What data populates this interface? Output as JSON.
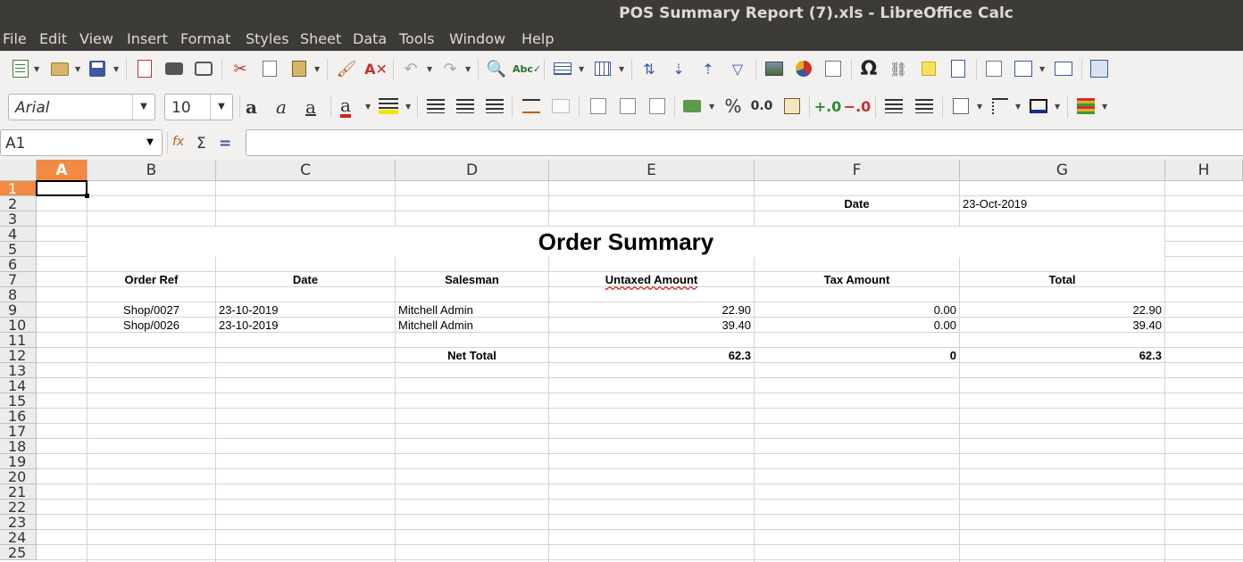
{
  "window": {
    "title": "POS Summary Report (7).xls - LibreOffice Calc"
  },
  "menu": [
    "File",
    "Edit",
    "View",
    "Insert",
    "Format",
    "Styles",
    "Sheet",
    "Data",
    "Tools",
    "Window",
    "Help"
  ],
  "format": {
    "font_name": "Arial",
    "font_size": "10"
  },
  "formula_bar": {
    "cell_ref": "A1",
    "formula": ""
  },
  "columns": [
    "A",
    "B",
    "C",
    "D",
    "E",
    "F",
    "G",
    "H"
  ],
  "rows": [
    "1",
    "2",
    "3",
    "4",
    "5",
    "6",
    "7",
    "8",
    "9",
    "10",
    "11",
    "12",
    "13",
    "14",
    "15",
    "16",
    "17",
    "18",
    "19",
    "20",
    "21",
    "22",
    "23",
    "24",
    "25"
  ],
  "report": {
    "date_label": "Date",
    "date_value": "23-Oct-2019",
    "title": "Order Summary",
    "headers": [
      "Order Ref",
      "Date",
      "Salesman",
      "Untaxed Amount",
      "Tax Amount",
      "Total"
    ],
    "orders": [
      {
        "ref": "Shop/0027",
        "date": "23-10-2019",
        "salesman": "Mitchell Admin",
        "untaxed": "22.90",
        "tax": "0.00",
        "total": "22.90"
      },
      {
        "ref": "Shop/0026",
        "date": "23-10-2019",
        "salesman": "Mitchell Admin",
        "untaxed": "39.40",
        "tax": "0.00",
        "total": "39.40"
      }
    ],
    "net_total": {
      "label": "Net Total",
      "untaxed": "62.3",
      "tax": "0",
      "total": "62.3"
    }
  }
}
